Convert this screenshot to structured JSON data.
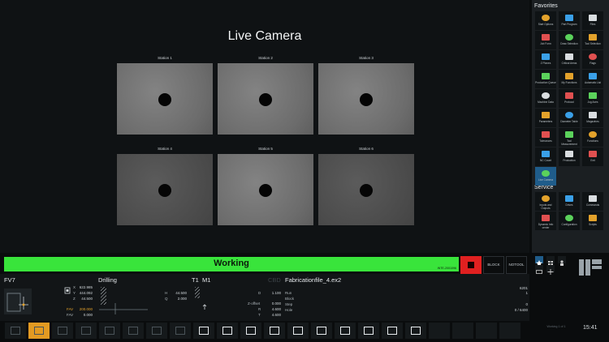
{
  "main": {
    "title": "Live Camera",
    "stations": [
      {
        "label": "Station 1"
      },
      {
        "label": "Station 2"
      },
      {
        "label": "Station 3"
      },
      {
        "label": "Station 4"
      },
      {
        "label": "Station 5"
      },
      {
        "label": "Station 6"
      }
    ]
  },
  "favorites": {
    "title": "Favorites",
    "items": [
      {
        "label": "Start Options",
        "icon": "play-icon"
      },
      {
        "label": "Part Program",
        "icon": "program-icon"
      },
      {
        "label": "Files",
        "icon": "files-icon"
      },
      {
        "label": "Job Form",
        "icon": "job-form-icon"
      },
      {
        "label": "Draw Selection",
        "icon": "draw-selection-icon"
      },
      {
        "label": "Tool Selection",
        "icon": "tool-selection-icon"
      },
      {
        "label": "Z Planes",
        "icon": "z-planes-icon"
      },
      {
        "label": "Critical Areas",
        "icon": "critical-areas-icon"
      },
      {
        "label": "Flags",
        "icon": "flags-icon"
      },
      {
        "label": "Production Queue",
        "icon": "production-queue-icon"
      },
      {
        "label": "My Functions",
        "icon": "my-functions-icon"
      },
      {
        "label": "Automatic List",
        "icon": "automatic-list-icon"
      },
      {
        "label": "Machine Data",
        "icon": "machine-data-icon"
      },
      {
        "label": "Protocol",
        "icon": "protocol-icon"
      },
      {
        "label": "Jog Axes",
        "icon": "jog-axes-icon"
      },
      {
        "label": "Parameters",
        "icon": "parameters-icon"
      },
      {
        "label": "Diameter Table",
        "icon": "diameter-table-icon"
      },
      {
        "label": "Magazines",
        "icon": "magazines-icon"
      },
      {
        "label": "Tolerances",
        "icon": "tolerances-icon"
      },
      {
        "label": "Tool Measurement",
        "icon": "tool-measurement-icon"
      },
      {
        "label": "Functions",
        "icon": "functions-icon"
      },
      {
        "label": "NC Count",
        "icon": "nc-count-icon"
      },
      {
        "label": "Production",
        "icon": "production-icon"
      },
      {
        "label": "Exit",
        "icon": "exit-icon"
      },
      {
        "label": "Live Camera",
        "icon": "camera-monitor-icon"
      }
    ]
  },
  "service": {
    "title": "Service",
    "items": [
      {
        "label": "Inputs and Outputs",
        "icon": "io-icon"
      },
      {
        "label": "Drives",
        "icon": "drives-icon"
      },
      {
        "label": "Commands",
        "icon": "commands-icon"
      },
      {
        "label": "Dynamic Info center",
        "icon": "info-center-icon"
      },
      {
        "label": "Configuration",
        "icon": "configuration-icon"
      },
      {
        "label": "Scripts",
        "icon": "scripts-icon"
      }
    ]
  },
  "status": {
    "text": "Working",
    "code": "INTE-2001096",
    "block_label": "BLOCK",
    "notool_label": "NOTOOL"
  },
  "bottom": {
    "fv_label": "FV7",
    "drilling_label": "Drilling",
    "t1_label": "T1",
    "m1_label": "M1",
    "cbd_label": "CBD",
    "file_label": "Fabricationfile_4.ex2",
    "axes": [
      {
        "name": "X",
        "value": "622.985"
      },
      {
        "name": "Y",
        "value": "444.092"
      },
      {
        "name": "Z",
        "value": "44.500"
      }
    ],
    "fav": {
      "name": "FAV",
      "value": "200.000"
    },
    "fav2": {
      "name": "FAV",
      "value": "0.000"
    },
    "drill": [
      {
        "name": "H",
        "value": "44.500"
      },
      {
        "name": "Q",
        "value": "2.000"
      }
    ],
    "t1": [
      {
        "name": "D",
        "value": "1.100"
      },
      {
        "name": "Z-offset",
        "value": "0.000"
      },
      {
        "name": "R",
        "value": "4.600"
      },
      {
        "name": "T",
        "value": "4.600"
      }
    ],
    "file_rows": [
      {
        "name": "Run",
        "value": "1"
      },
      {
        "name": "Block",
        "value": ""
      },
      {
        "name": "Step",
        "value": "0"
      },
      {
        "name": "Hole",
        "value": "0 / 6400"
      }
    ],
    "file_count": "6201"
  },
  "footer": {
    "version": "Working  1 of 1",
    "clock": "15:41"
  }
}
